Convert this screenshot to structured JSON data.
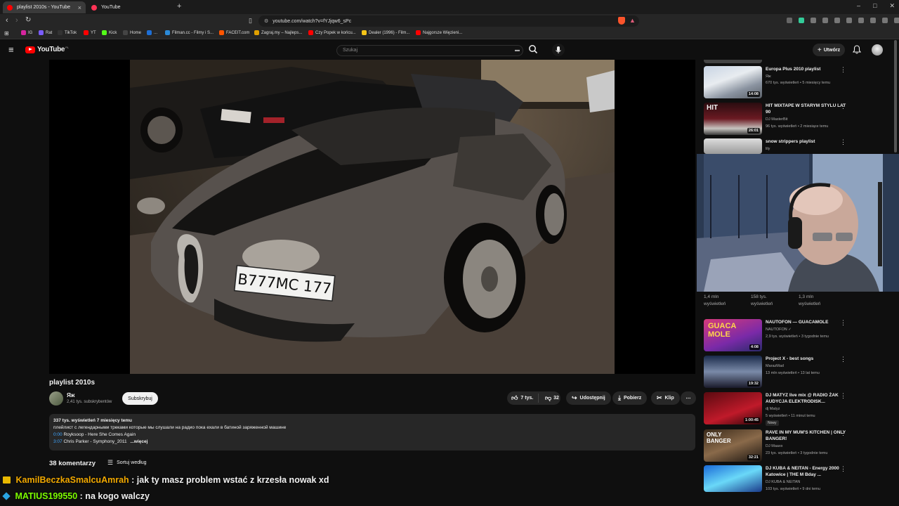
{
  "browser": {
    "tabs": [
      {
        "title": "playlist 2010s - YouTube",
        "active": true,
        "close": "×"
      },
      {
        "title": "YouTube",
        "active": false
      }
    ],
    "new_tab": "+",
    "win_controls": [
      "–",
      "□",
      "✕"
    ],
    "url": "youtube.com/watch?v=fYJjqw6_sPc",
    "bookmarks": [
      {
        "label": "IG",
        "color": "#d6249f"
      },
      {
        "label": "Rat",
        "color": "#7a5cff"
      },
      {
        "label": "TikTok",
        "color": "#111111"
      },
      {
        "label": "YT",
        "color": "#ff0000"
      },
      {
        "label": "Kick",
        "color": "#53fc18"
      },
      {
        "label": "Home",
        "color": "#444444"
      },
      {
        "label": "...",
        "color": "#1d6fd6"
      },
      {
        "label": "Filman.cc - Filmy i S...",
        "color": "#2b8ad8"
      },
      {
        "label": "FACEIT.com",
        "color": "#ff5500"
      },
      {
        "label": "Zagraj.my – Najleps...",
        "color": "#e0a000"
      },
      {
        "label": "Czy Popek w końcu...",
        "color": "#ff0000"
      },
      {
        "label": "Dealer (1996) - Film...",
        "color": "#f5c518"
      },
      {
        "label": "Najgorsze Więzieni...",
        "color": "#ff0000"
      }
    ]
  },
  "header": {
    "logo": "YouTube",
    "logo_region": "PL",
    "search_placeholder": "Szukaj",
    "create_label": "Utwórz"
  },
  "video": {
    "plate": "В777МС 177",
    "title": "playlist 2010s",
    "channel": "Яж",
    "subscribers": "2,41 tys. subskrybentów",
    "subscribe_label": "Subskrybuj",
    "likes": "7 tys.",
    "dislikes": "32",
    "share_label": "Udostępnij",
    "download_label": "Pobierz",
    "clip_label": "Klip",
    "more_label": "⋯"
  },
  "description": {
    "stats": "337 tys. wyświetleń  7 miesięcy temu",
    "text": "плейлист с легендарными треками которые мы слушали на радио пока ехали в батиной заряженной машине",
    "tracks": [
      {
        "time": "0:00",
        "title": "Royksoop - Here She Comes Again"
      },
      {
        "time": "3:07",
        "title": "Chris Parker - Symphony_2011"
      }
    ],
    "more": "...więcej"
  },
  "comments": {
    "count": "38 komentarzy",
    "sort_label": "Sortuj według"
  },
  "chat": [
    {
      "user": "KamilBeczkaSmalcuAmrah",
      "message": ": jak ty masz problem wstać z krzesła nowak  xd",
      "color": "#f2a900"
    },
    {
      "user": "MATIUS199550",
      "message": ": na kogo walczy",
      "color": "#7cfc00"
    }
  ],
  "recommendations_top": [
    {
      "title": "Europa Plus 2010 playlist",
      "channel": "Яж",
      "views": "670 tys. wyświetleń • 5 miesięcy temu",
      "duration": "14:08"
    },
    {
      "title": "HIT MIXTAPE W STARYM STYLU LAT 90",
      "channel": "DJ MasterBit",
      "views": "96 tys. wyświetleń • 2 miesiące temu",
      "duration": "26:01"
    },
    {
      "title": "snow strippers playlist",
      "channel": "lily",
      "views": "",
      "duration": ""
    }
  ],
  "stats_row": [
    {
      "value": "1,4 mln",
      "label": "wyświetleń"
    },
    {
      "value": "158 tys.",
      "label": "wyświetleń"
    },
    {
      "value": "1,3 mln",
      "label": "wyświetleń"
    }
  ],
  "recommendations_bottom": [
    {
      "title": "NAUTOFON — GUACAMOLE",
      "channel": "NAUTOFON ✓",
      "views": "2,9 tys. wyświetleń • 3 tygodnie temu",
      "duration": "4:08"
    },
    {
      "title": "Project X - best songs",
      "channel": "MarazMad",
      "views": "13 mln wyświetleń • 13 lat temu",
      "duration": "19:32"
    },
    {
      "title": "DJ MATYZ live mix @ RADIO ŻAK AUDYCJA ELEKTRODISK...",
      "channel": "dj Matyz",
      "views": "5 wyświetleń • 11 minut temu",
      "duration": "1:00:45",
      "badge": "Nowy"
    },
    {
      "title": "RAVE IN MY MUM'S KITCHEN | ONLY BANGER!",
      "channel": "DJ Maaxx",
      "views": "23 tys. wyświetleń • 3 tygodnie temu",
      "duration": "32:21"
    },
    {
      "title": "DJ KUBA & NEITAN - Energy 2000 Katowice | THE M Bday ...",
      "channel": "DJ KUBA & NEITAN",
      "views": "103 tys. wyświetleń • 9 dni temu",
      "duration": ""
    }
  ],
  "thumb_texts": {
    "guaca": "GUACA MOLE",
    "onlybanger": "ONLY BANGER",
    "hit": "HIT"
  }
}
